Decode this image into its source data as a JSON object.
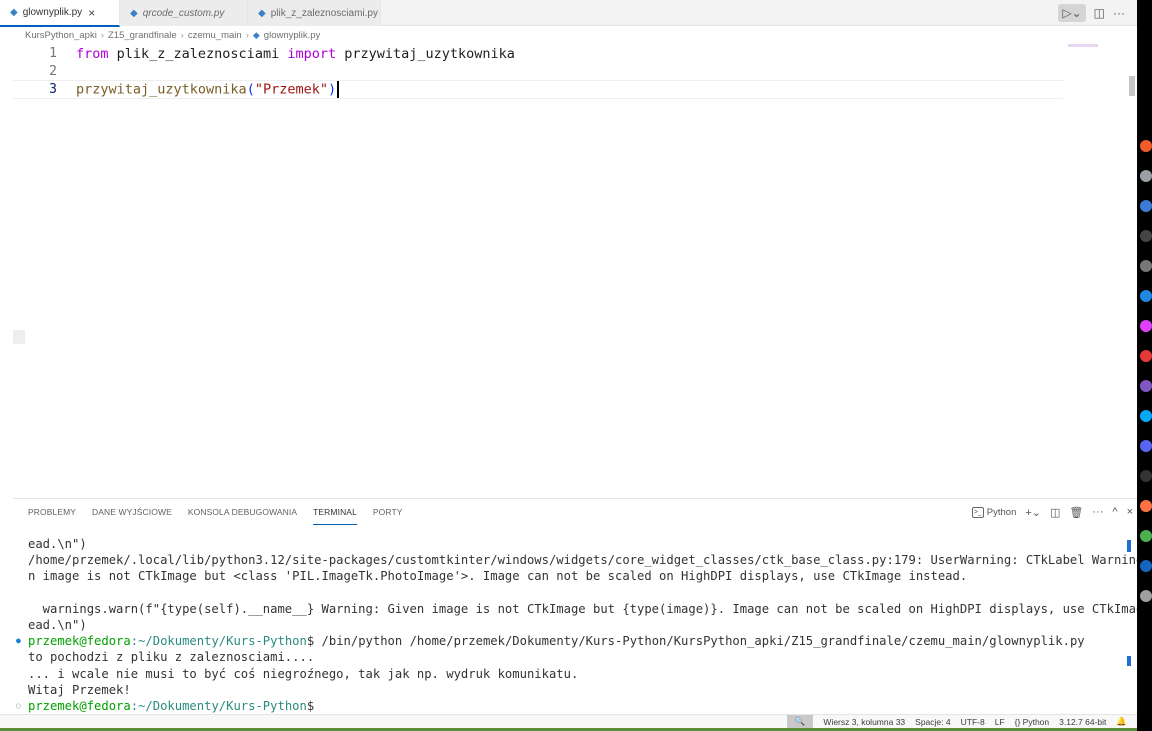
{
  "tabs": [
    {
      "label": "glownyplik.py",
      "active": true,
      "italic": false
    },
    {
      "label": "qrcode_custom.py",
      "active": false,
      "italic": true
    },
    {
      "label": "plik_z_zaleznosciami.py",
      "active": false,
      "italic": false
    }
  ],
  "breadcrumb": [
    "KursPython_apki",
    "Z15_grandfinale",
    "czemu_main",
    "glownyplik.py"
  ],
  "editor": {
    "lines": [
      {
        "num": "1",
        "tokens": [
          {
            "t": "from",
            "c": "kw"
          },
          {
            "t": " plik_z_zaleznosciami ",
            "c": ""
          },
          {
            "t": "import",
            "c": "kw"
          },
          {
            "t": " przywitaj_uzytkownika",
            "c": ""
          }
        ]
      },
      {
        "num": "2",
        "tokens": []
      },
      {
        "num": "3",
        "tokens": [
          {
            "t": "przywitaj_uzytkownika",
            "c": "fn"
          },
          {
            "t": "(",
            "c": "br"
          },
          {
            "t": "\"Przemek\"",
            "c": "str"
          },
          {
            "t": ")",
            "c": "br"
          }
        ]
      }
    ]
  },
  "panel": {
    "tabs": [
      "PROBLEMY",
      "DANE WYJŚCIOWE",
      "KONSOLA DEBUGOWANIA",
      "TERMINAL",
      "PORTY"
    ],
    "active_tab": "TERMINAL",
    "terminal_name": "Python"
  },
  "terminal": {
    "lines": [
      "ead.\\n\")",
      "/home/przemek/.local/lib/python3.12/site-packages/customtkinter/windows/widgets/core_widget_classes/ctk_base_class.py:179: UserWarning: CTkLabel Warning: Give",
      "n image is not CTkImage but <class 'PIL.ImageTk.PhotoImage'>. Image can not be scaled on HighDPI displays, use CTkImage instead.",
      "",
      "  warnings.warn(f\"{type(self).__name__} Warning: Given image is not CTkImage but {type(image)}. Image can not be scaled on HighDPI displays, use CTkImage inst",
      "ead.\\n\")"
    ],
    "prompt1_user": "przemek@fedora",
    "prompt1_path": ":~/Dokumenty/Kurs-Python",
    "prompt1_cmd": "$ /bin/python /home/przemek/Dokumenty/Kurs-Python/KursPython_apki/Z15_grandfinale/czemu_main/glownyplik.py",
    "output": [
      "to pochodzi z pliku z zaleznosciami....",
      "... i wcale nie musi to być coś niegroźnego, tak jak np. wydruk komunikatu.",
      "Witaj Przemek!"
    ],
    "prompt2_user": "przemek@fedora",
    "prompt2_path": ":~/Dokumenty/Kurs-Python",
    "prompt2_cmd": "$"
  },
  "statusbar": {
    "position": "Wiersz 3, kolumna 33",
    "spaces": "Spacje: 4",
    "encoding": "UTF-8",
    "eol": "LF",
    "language": "{} Python",
    "interpreter": "3.12.7 64-bit"
  },
  "dock_colors": [
    "#f25b2a",
    "#9aa0a6",
    "#3a7bd5",
    "#444444",
    "#777777",
    "#1e88e5",
    "#e040fb",
    "#e53935",
    "#7e57c2",
    "#03a9f4",
    "#5865f2",
    "#333333",
    "#ff7043",
    "#4caf50",
    "#1565c0",
    "#9e9e9e"
  ]
}
